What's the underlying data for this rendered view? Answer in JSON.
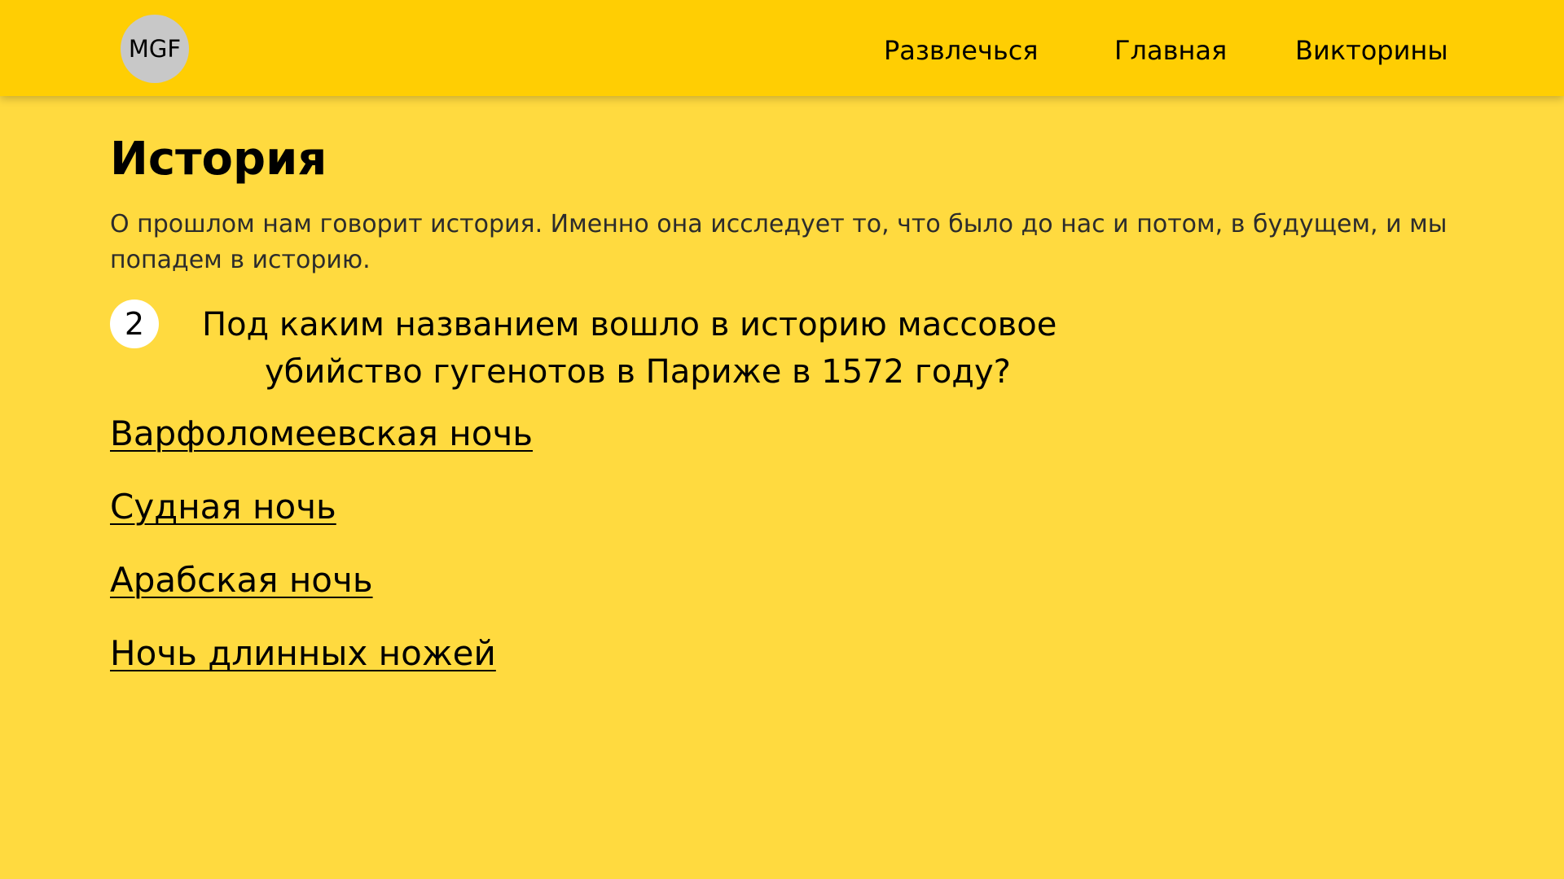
{
  "header": {
    "logo_text": "MGF",
    "nav": [
      {
        "label": "Развлечься"
      },
      {
        "label": "Главная"
      },
      {
        "label": "Викторины"
      }
    ]
  },
  "main": {
    "title": "История",
    "intro": "О прошлом нам говорит история. Именно она исследует то, что было до нас и потом, в будущем, и мы попадем в историю.",
    "question": {
      "number": "2",
      "line1": "Под каким названием вошло в историю массовое",
      "line2": "убийство гугенотов в Париже в 1572 году?"
    },
    "answers": [
      {
        "label": "Варфоломеевская ночь"
      },
      {
        "label": "Судная ночь"
      },
      {
        "label": "Арабская ночь"
      },
      {
        "label": "Ночь длинных ножей"
      }
    ]
  },
  "colors": {
    "page_background": "#FFDA3F",
    "header_background": "#FFCE03",
    "logo_background": "#C8C8C8",
    "badge_background": "#FFFFFF",
    "text": "#000000"
  }
}
